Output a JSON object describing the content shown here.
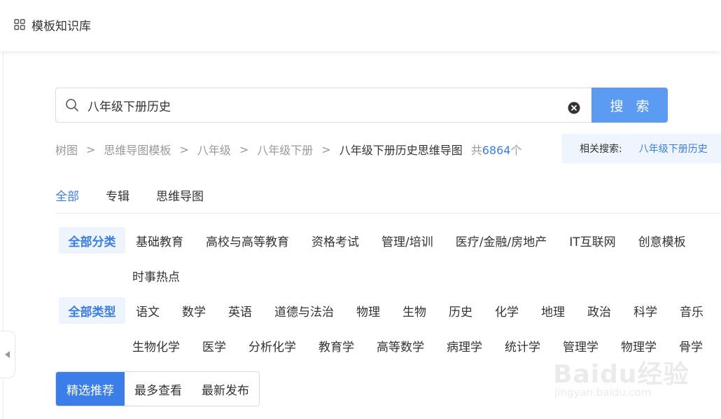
{
  "header": {
    "title": "模板知识库",
    "icon": "grid-icon"
  },
  "search": {
    "value": "八年级下册历史",
    "placeholder": "",
    "button_label": "搜 索"
  },
  "breadcrumb": {
    "items": [
      "树图",
      "思维导图模板",
      "八年级",
      "八年级下册"
    ],
    "separator": ">",
    "current": "八年级下册历史思维导图",
    "total_prefix": "共",
    "total_count": "6864",
    "total_suffix": "个"
  },
  "related": {
    "label": "相关搜索:",
    "link": "八年级下册历史"
  },
  "tabs": [
    {
      "label": "全部",
      "active": true
    },
    {
      "label": "专辑",
      "active": false
    },
    {
      "label": "思维导图",
      "active": false
    }
  ],
  "filters": {
    "category": {
      "head": "全部分类",
      "items_row1": [
        "基础教育",
        "高校与高等教育",
        "资格考试",
        "管理/培训",
        "医疗/金融/房地产",
        "IT互联网",
        "创意模板"
      ],
      "items_row2": [
        "时事热点"
      ]
    },
    "type": {
      "head": "全部类型",
      "items_row1": [
        "语文",
        "数学",
        "英语",
        "道德与法治",
        "物理",
        "生物",
        "历史",
        "化学",
        "地理",
        "政治",
        "科学",
        "音乐"
      ],
      "items_row2": [
        "生物化学",
        "医学",
        "分析化学",
        "教育学",
        "高等数学",
        "病理学",
        "统计学",
        "管理学",
        "物理学",
        "骨学"
      ]
    }
  },
  "sort": [
    {
      "label": "精选推荐",
      "active": true
    },
    {
      "label": "最多查看",
      "active": false
    },
    {
      "label": "最新发布",
      "active": false
    }
  ],
  "watermark": {
    "main": "Baidu经验",
    "sub": "jingyan.baidu.com"
  },
  "colors": {
    "accent": "#3b7de9",
    "search_button": "#5b9cf2",
    "filter_head_bg": "#eef4fc",
    "related_bg": "#eef5ff"
  }
}
